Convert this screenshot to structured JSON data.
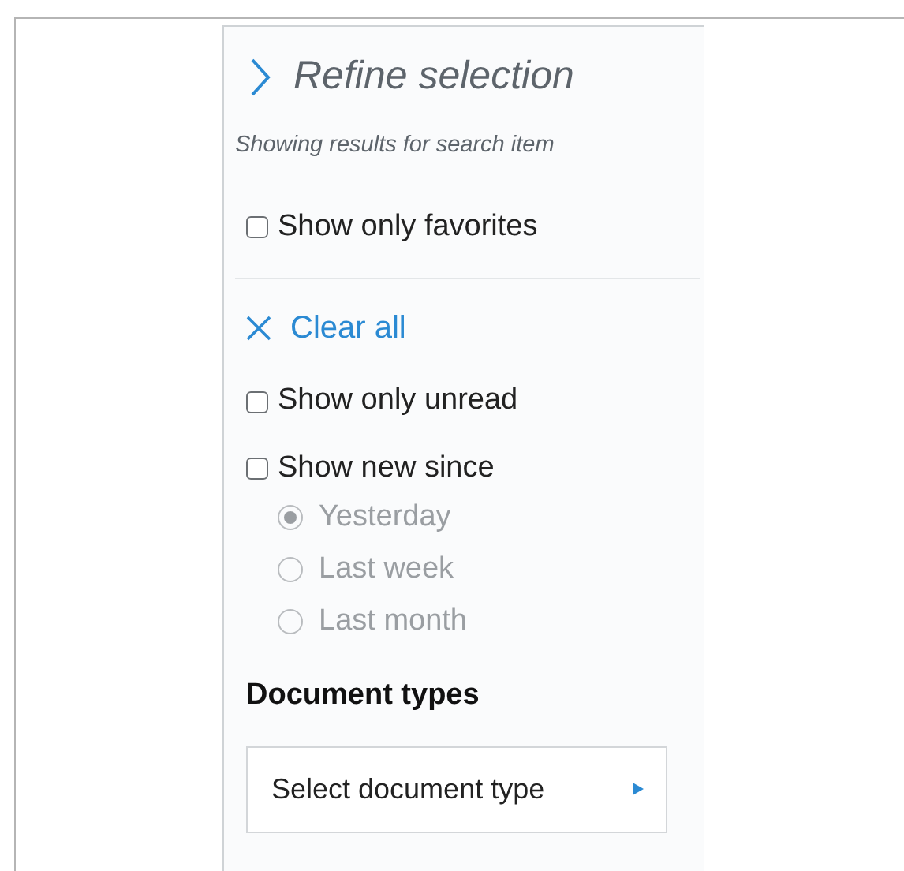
{
  "panel": {
    "title": "Refine selection",
    "subtitle": "Showing results for search item"
  },
  "favorites": {
    "label": "Show only favorites",
    "checked": false
  },
  "clear_all": {
    "label": "Clear all"
  },
  "filters": [
    {
      "label": "Show only unread",
      "checked": false
    },
    {
      "label": "Show new since",
      "checked": false
    }
  ],
  "since_options": [
    {
      "label": "Yesterday",
      "selected": true,
      "disabled": true
    },
    {
      "label": "Last week",
      "selected": false,
      "disabled": true
    },
    {
      "label": "Last month",
      "selected": false,
      "disabled": true
    }
  ],
  "document_types": {
    "heading": "Document types",
    "dropdown": "Select document type"
  }
}
